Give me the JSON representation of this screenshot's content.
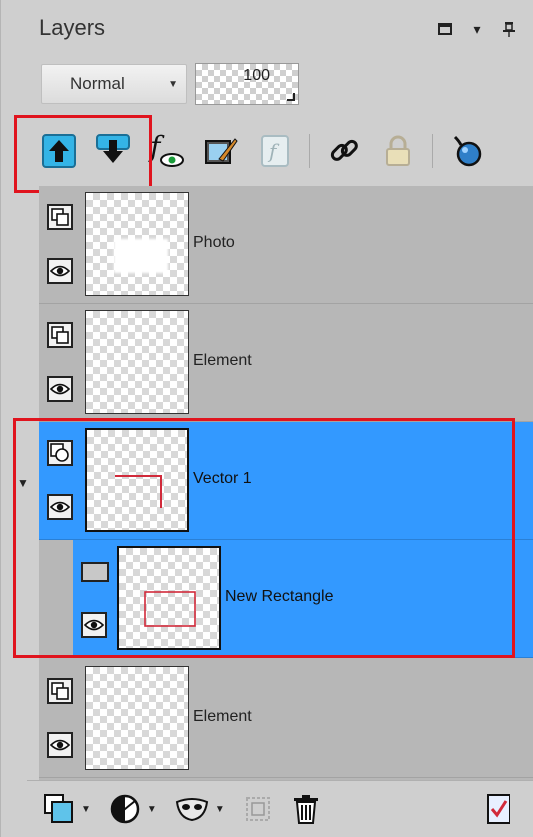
{
  "panel": {
    "title": "Layers",
    "controls": [
      "restore-icon",
      "menu-caret-icon",
      "pin-icon"
    ]
  },
  "blend": {
    "mode": "Normal",
    "opacity": "100"
  },
  "toolbar": {
    "icons": [
      "move-layer-up-icon",
      "move-layer-down-icon",
      "layer-styles-icon",
      "edit-selection-icon",
      "fx-icon",
      "link-icon",
      "lock-icon",
      "mask-icon"
    ]
  },
  "layers": [
    {
      "name": "Photo",
      "type": "raster",
      "visible": true
    },
    {
      "name": "Element",
      "type": "raster",
      "visible": true
    },
    {
      "name": "Vector 1",
      "type": "vector",
      "visible": true,
      "selected": true,
      "expanded": true
    },
    {
      "name": "New Rectangle",
      "type": "object",
      "visible": true,
      "selected": true,
      "child": true
    },
    {
      "name": "Element",
      "type": "raster",
      "visible": true
    }
  ],
  "colors": {
    "selection": "#3399ff",
    "highlight": "#e0141e",
    "icon_blue": "#34b4e6"
  }
}
